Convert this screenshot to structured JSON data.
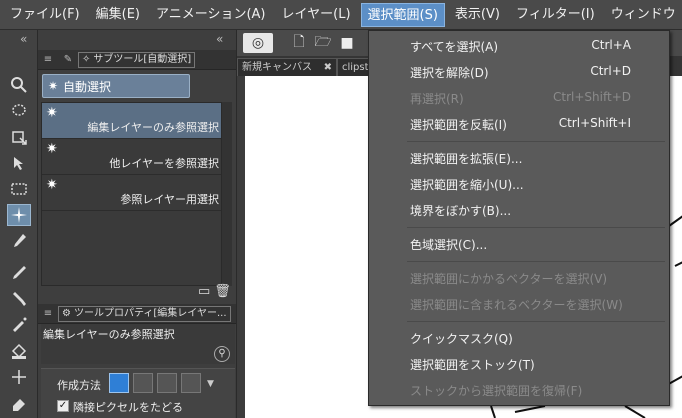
{
  "menubar": {
    "items": [
      "ファイル(F)",
      "編集(E)",
      "アニメーション(A)",
      "レイヤー(L)",
      "選択範囲(S)",
      "表示(V)",
      "フィルター(I)",
      "ウィンドウ"
    ]
  },
  "subtool_panel": {
    "header_title": "サブツール[自動選択]",
    "group_label": "自動選択",
    "subtools": [
      {
        "label": "編集レイヤーのみ参照選択"
      },
      {
        "label": "他レイヤーを参照選択"
      },
      {
        "label": "参照レイヤー用選択"
      }
    ]
  },
  "tool_property": {
    "header_title": "ツールプロパティ[編集レイヤー...",
    "name": "編集レイヤーのみ参照選択",
    "method_label": "作成方法",
    "checkbox_label": "隣接ピクセルをたどる",
    "checkbox_checked": true
  },
  "canvas_tabs": [
    "新規キャンバス",
    "clipst"
  ],
  "selection_menu": {
    "items": [
      {
        "label": "すべてを選択(A)",
        "shortcut": "Ctrl+A",
        "enabled": true
      },
      {
        "label": "選択を解除(D)",
        "shortcut": "Ctrl+D",
        "enabled": true
      },
      {
        "label": "再選択(R)",
        "shortcut": "Ctrl+Shift+D",
        "enabled": false
      },
      {
        "label": "選択範囲を反転(I)",
        "shortcut": "Ctrl+Shift+I",
        "enabled": true
      },
      {
        "label": "選択範囲を拡張(E)...",
        "shortcut": "",
        "enabled": true
      },
      {
        "label": "選択範囲を縮小(U)...",
        "shortcut": "",
        "enabled": true
      },
      {
        "label": "境界をぼかす(B)...",
        "shortcut": "",
        "enabled": true
      },
      {
        "label": "色域選択(C)...",
        "shortcut": "",
        "enabled": true
      },
      {
        "label": "選択範囲にかかるベクターを選択(V)",
        "shortcut": "",
        "enabled": false
      },
      {
        "label": "選択範囲に含まれるベクターを選択(W)",
        "shortcut": "",
        "enabled": false
      },
      {
        "label": "クイックマスク(Q)",
        "shortcut": "",
        "enabled": true
      },
      {
        "label": "選択範囲をストック(T)",
        "shortcut": "",
        "enabled": true
      },
      {
        "label": "ストックから選択範囲を復帰(F)",
        "shortcut": "",
        "enabled": false
      }
    ]
  },
  "colors": {
    "accent": "#5c8fc7",
    "menu_bg": "#5a5a5a",
    "selected_subtool": "#5b6f85"
  }
}
